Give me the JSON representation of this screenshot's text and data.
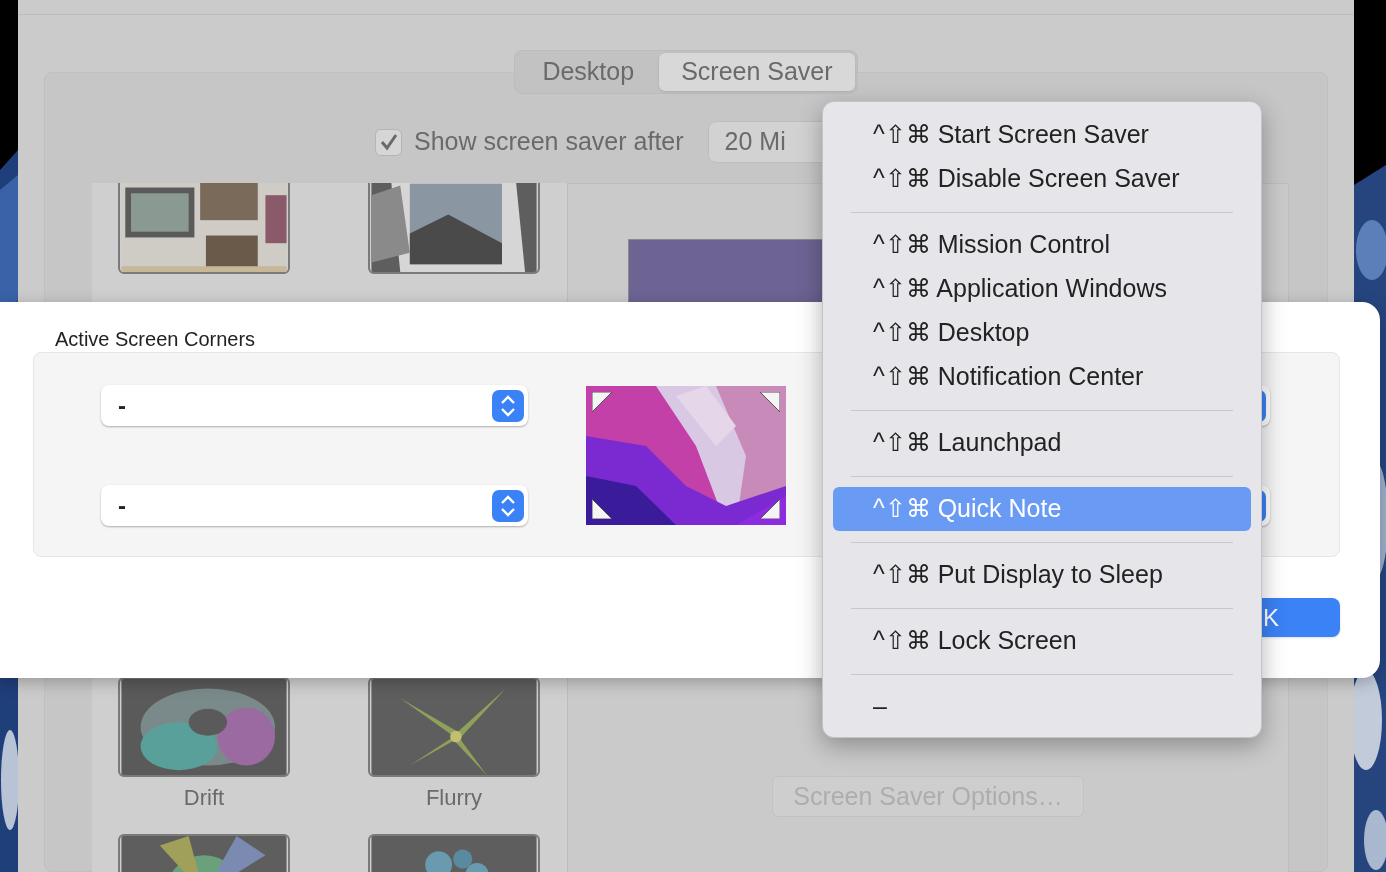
{
  "window": {
    "tabs": [
      {
        "label": "Desktop",
        "selected": false
      },
      {
        "label": "Screen Saver",
        "selected": true
      }
    ],
    "show_after": {
      "label": "Show screen saver after",
      "checked": true,
      "value": "20 Mi"
    },
    "screen_savers": [
      {
        "kind": "picture"
      },
      {
        "kind": "picture"
      },
      {
        "kind": "tile",
        "label": "Drift"
      },
      {
        "kind": "tile",
        "label": "Flurry"
      },
      {
        "kind": "picture"
      },
      {
        "kind": "picture"
      }
    ],
    "options_button": {
      "label": "Screen Saver Options…",
      "disabled": true
    }
  },
  "sheet": {
    "title": "Active Screen Corners",
    "left_corners": [
      {
        "value": "-"
      },
      {
        "value": "-"
      }
    ],
    "ok_button": "K"
  },
  "menu": {
    "items": [
      {
        "kind": "item",
        "label": "^⇧⌘ Start Screen Saver",
        "selected": false
      },
      {
        "kind": "item",
        "label": "^⇧⌘ Disable Screen Saver",
        "selected": false
      },
      {
        "kind": "separator"
      },
      {
        "kind": "item",
        "label": "^⇧⌘ Mission Control",
        "selected": false
      },
      {
        "kind": "item",
        "label": "^⇧⌘ Application Windows",
        "selected": false
      },
      {
        "kind": "item",
        "label": "^⇧⌘ Desktop",
        "selected": false
      },
      {
        "kind": "item",
        "label": "^⇧⌘ Notification Center",
        "selected": false
      },
      {
        "kind": "separator"
      },
      {
        "kind": "item",
        "label": "^⇧⌘ Launchpad",
        "selected": false
      },
      {
        "kind": "separator"
      },
      {
        "kind": "item",
        "label": "^⇧⌘ Quick Note",
        "selected": true
      },
      {
        "kind": "separator"
      },
      {
        "kind": "item",
        "label": "^⇧⌘ Put Display to Sleep",
        "selected": false
      },
      {
        "kind": "separator"
      },
      {
        "kind": "item",
        "label": "^⇧⌘ Lock Screen",
        "selected": false
      },
      {
        "kind": "separator"
      },
      {
        "kind": "item",
        "label": "–",
        "selected": false
      }
    ]
  }
}
